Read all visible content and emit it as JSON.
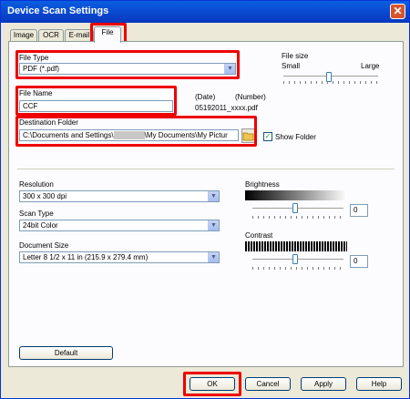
{
  "window": {
    "title": "Device Scan Settings",
    "close_glyph": "✕"
  },
  "tabs": [
    "Image",
    "OCR",
    "E-mail",
    "File"
  ],
  "file_type": {
    "label": "File Type",
    "value": "PDF (*.pdf)"
  },
  "file_size": {
    "label": "File size",
    "small": "Small",
    "large": "Large",
    "level": 0.55
  },
  "file_name": {
    "label": "File Name",
    "value": "CCF",
    "date_label": "(Date)",
    "number_label": "(Number)",
    "preview": "05192011_xxxx.pdf"
  },
  "destination": {
    "label": "Destination Folder",
    "value_start": "C:\\Documents and Settings\\",
    "value_end": "\\My Documents\\My Pictur",
    "show_folder": "Show Folder",
    "show_folder_checked": true
  },
  "resolution": {
    "label": "Resolution",
    "value": "300 x 300 dpi"
  },
  "scan_type": {
    "label": "Scan Type",
    "value": "24bit Color"
  },
  "document_size": {
    "label": "Document Size",
    "value": "Letter 8 1/2 x 11 in (215.9 x 279.4 mm)"
  },
  "brightness": {
    "label": "Brightness",
    "value": "0"
  },
  "contrast": {
    "label": "Contrast",
    "value": "0"
  },
  "buttons": {
    "default": "Default",
    "ok": "OK",
    "cancel": "Cancel",
    "apply": "Apply",
    "help": "Help"
  },
  "icons": {
    "check": "✓",
    "dropdown_arrow": "▼",
    "folder": "folder-icon"
  }
}
